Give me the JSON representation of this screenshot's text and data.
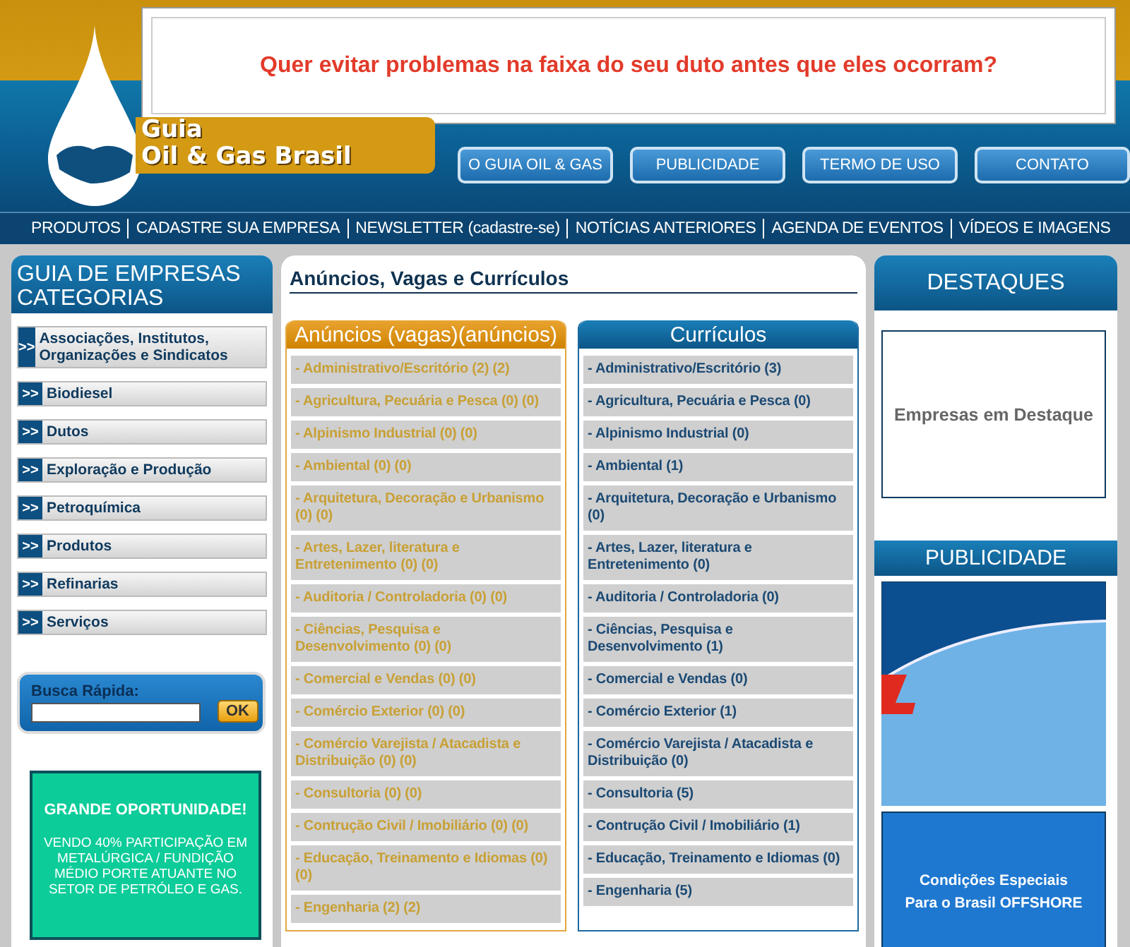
{
  "banner": {
    "text": "Quer evitar problemas na faixa do seu duto antes que eles ocorram?"
  },
  "logo": {
    "line_1": "Guia",
    "line_2": "Oil & Gas Brasil"
  },
  "top_buttons": [
    "O GUIA OIL & GAS",
    "PUBLICIDADE",
    "TERMO DE USO",
    "CONTATO"
  ],
  "nav_links": [
    "PRODUTOS",
    "CADASTRE SUA EMPRESA",
    "NEWSLETTER (cadastre-se)",
    "NOTÍCIAS ANTERIORES",
    "AGENDA DE EVENTOS",
    "VÍDEOS E IMAGENS"
  ],
  "sidebar": {
    "title": "GUIA DE EMPRESAS CATEGORIAS",
    "items": [
      {
        "marker": ">>",
        "label": "Associações, Institutos, Organizações e Sindicatos"
      },
      {
        "marker": ">>",
        "label": "Biodiesel"
      },
      {
        "marker": ">>",
        "label": "Dutos"
      },
      {
        "marker": ">>",
        "label": "Exploração e Produção"
      },
      {
        "marker": ">>",
        "label": "Petroquímica"
      },
      {
        "marker": ">>",
        "label": "Produtos"
      },
      {
        "marker": ">>",
        "label": "Refinarias"
      },
      {
        "marker": ">>",
        "label": "Serviços"
      }
    ],
    "search": {
      "label": "Busca Rápida:",
      "button": "OK"
    },
    "ad": {
      "title": "GRANDE OPORTUNIDADE!",
      "text": "VENDO 40%  PARTICIPAÇÃO EM METALÚRGICA / FUNDIÇÃO MÉDIO PORTE ATUANTE NO SETOR DE PETRÓLEO E GAS."
    }
  },
  "main": {
    "title": "Anúncios, Vagas e Currículos",
    "columns": [
      {
        "kind": "anuncios",
        "title": "Anúncios (vagas)(anúncios)",
        "items": [
          "- Administrativo/Escritório (2) (2)",
          "- Agricultura, Pecuária e Pesca (0) (0)",
          "- Alpinismo Industrial (0) (0)",
          "- Ambiental (0) (0)",
          "- Arquitetura, Decoração e Urbanismo (0) (0)",
          "- Artes, Lazer, literatura e Entretenimento (0) (0)",
          "- Auditoria / Controladoria (0) (0)",
          "- Ciências, Pesquisa e Desenvolvimento (0) (0)",
          "- Comercial e Vendas (0) (0)",
          "- Comércio Exterior (0) (0)",
          "- Comércio Varejista / Atacadista e Distribuição (0) (0)",
          "- Consultoria (0) (0)",
          "- Contrução Civil / Imobiliário (0) (0)",
          "- Educação, Treinamento e Idiomas (0) (0)",
          "- Engenharia (2) (2)"
        ]
      },
      {
        "kind": "curriculos",
        "title": "Currículos",
        "items": [
          "- Administrativo/Escritório (3)",
          "- Agricultura, Pecuária e Pesca (0)",
          "- Alpinismo Industrial (0)",
          "- Ambiental (1)",
          "- Arquitetura, Decoração e Urbanismo (0)",
          "- Artes, Lazer, literatura e Entretenimento (0)",
          "- Auditoria / Controladoria (0)",
          "- Ciências, Pesquisa e Desenvolvimento (1)",
          "- Comercial e Vendas (0)",
          "- Comércio Exterior (1)",
          "- Comércio Varejista / Atacadista e Distribuição (0)",
          "- Consultoria (5)",
          "- Contrução Civil / Imobiliário (1)",
          "- Educação, Treinamento e Idiomas (0)",
          "- Engenharia (5)"
        ]
      }
    ]
  },
  "right": {
    "highlights": {
      "title": "DESTAQUES",
      "text": "Empresas em Destaque"
    },
    "ads": {
      "title": "PUBLICIDADE",
      "caption_1": "Condições Especiais",
      "caption_2": "Para o Brasil OFFSHORE"
    }
  }
}
